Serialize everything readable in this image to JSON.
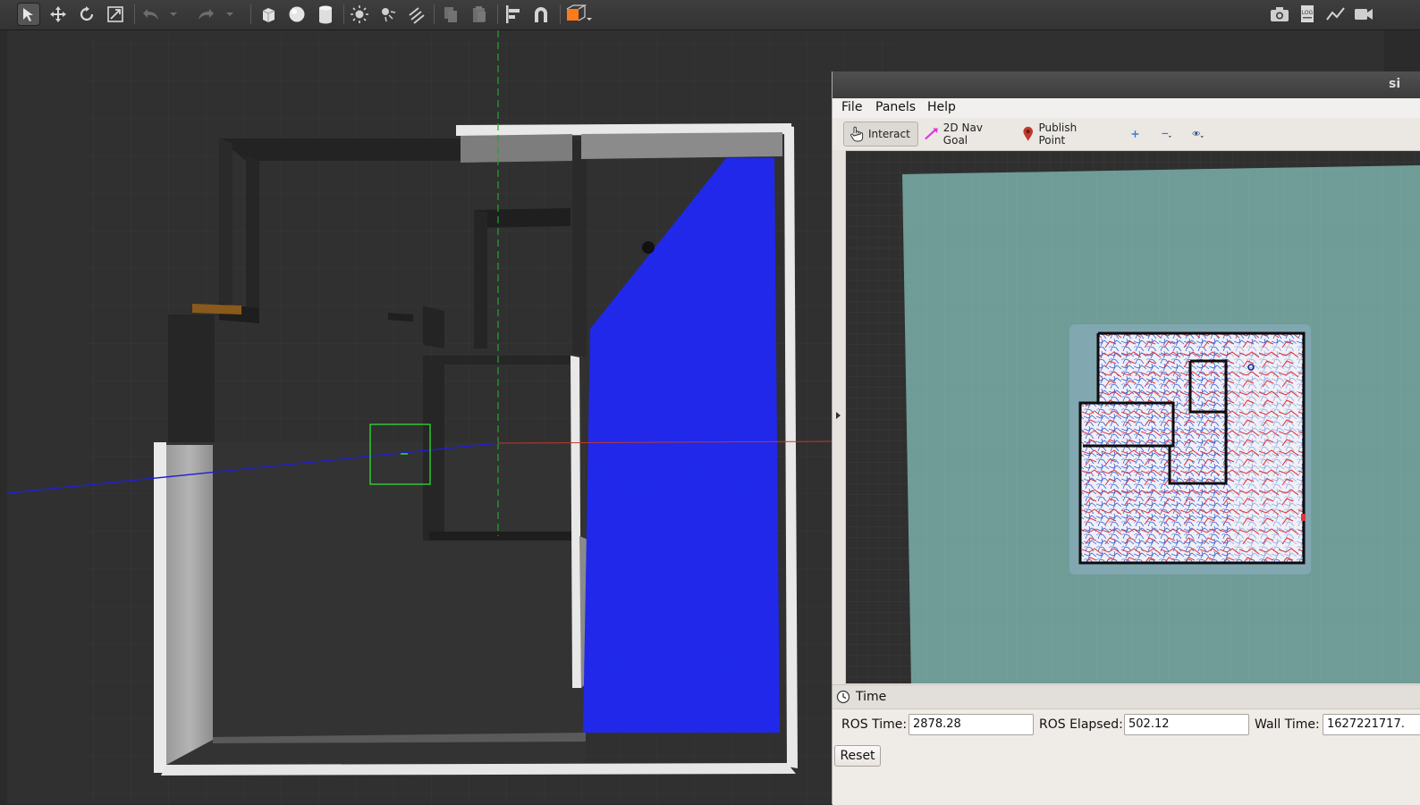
{
  "gazebo": {
    "toolbar": {
      "tools": [
        "select-mode",
        "translate-mode",
        "rotate-mode",
        "scale-mode",
        "undo",
        "redo",
        "box",
        "sphere",
        "cylinder",
        "point-light",
        "spot-light",
        "directional-light",
        "copy",
        "paste",
        "align",
        "snap",
        "change-view"
      ],
      "right_tools": [
        "screenshot",
        "log",
        "plot",
        "record-video"
      ]
    }
  },
  "rviz": {
    "window_title": "si",
    "menu": {
      "file": "File",
      "panels": "Panels",
      "help": "Help"
    },
    "tools": {
      "interact": "Interact",
      "nav_goal": "2D Nav Goal",
      "publish_point": "Publish Point"
    },
    "time_panel": {
      "title": "Time",
      "ros_time_label": "ROS Time:",
      "ros_time_value": "2878.28",
      "ros_elapsed_label": "ROS Elapsed:",
      "ros_elapsed_value": "502.12",
      "wall_time_label": "Wall Time:",
      "wall_time_value": "1627221717.",
      "reset_label": "Reset"
    }
  },
  "colors": {
    "gazebo_background": "#2b2b2b",
    "laser_blue": "#1f1fe0",
    "selection_green": "#2ecc40",
    "rviz_map_background": "#6f9c96",
    "costmap_red": "#e0353b",
    "costmap_blue": "#3a5fd1"
  }
}
